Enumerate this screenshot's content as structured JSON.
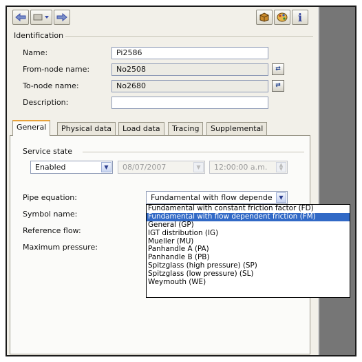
{
  "toolbar": {
    "back_icon": "arrow-left-icon",
    "dropdown_icon": "tools-dropdown-icon",
    "forward_icon": "arrow-right-icon",
    "box_icon": "package-icon",
    "palette_icon": "palette-icon",
    "info_label": "i"
  },
  "identification": {
    "section_label": "Identification",
    "name_label": "Name:",
    "name_value": "Pi2586",
    "from_label": "From-node name:",
    "from_value": "No2508",
    "to_label": "To-node name:",
    "to_value": "No2680",
    "description_label": "Description:",
    "description_value": ""
  },
  "tabs": [
    "General",
    "Physical data",
    "Load data",
    "Tracing",
    "Supplemental"
  ],
  "general": {
    "service_state_label": "Service state",
    "service_state_value": "Enabled",
    "date_value": "08/07/2007",
    "time_value": "12:00:00 a.m.",
    "pipe_equation_label": "Pipe equation:",
    "pipe_equation_value": "Fundamental with flow depende",
    "symbol_name_label": "Symbol name:",
    "reference_flow_label": "Reference flow:",
    "maximum_pressure_label": "Maximum pressure:"
  },
  "pipe_equation_options": [
    "Fundamental with constant friction factor (FD)",
    "Fundamental with flow dependent friction (FM)",
    "General (GP)",
    "IGT distribution (IG)",
    "Mueller (MU)",
    "Panhandle A (PA)",
    "Panhandle B (PB)",
    "Spitzglass (high pressure) (SP)",
    "Spitzglass (low pressure) (SL)",
    "Weymouth (WE)"
  ],
  "selected_option_index": 1,
  "colors": {
    "selection": "#3169c6",
    "active_tab_accent": "#e8a23a",
    "panel": "#f2f0e9"
  }
}
